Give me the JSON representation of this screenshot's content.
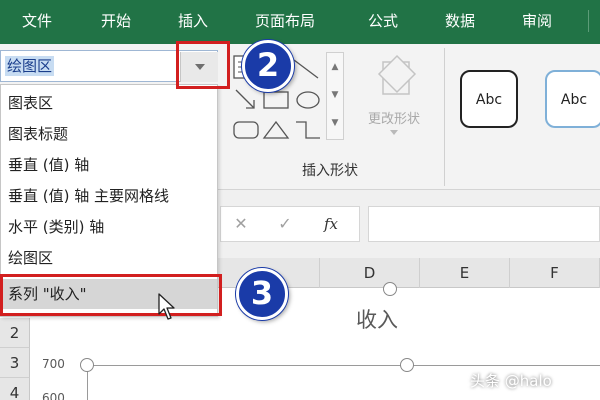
{
  "ribbon_tabs": [
    "文件",
    "开始",
    "插入",
    "页面布局",
    "公式",
    "数据",
    "审阅"
  ],
  "chart_element_selector": {
    "value": "绘图区",
    "options": [
      "图表区",
      "图表标题",
      "垂直 (值) 轴",
      "垂直 (值) 轴 主要网格线",
      "水平 (类别) 轴",
      "绘图区",
      "系列 \"收入\""
    ],
    "highlighted_option": "系列 \"收入\""
  },
  "insert_shapes": {
    "group_label": "插入形状",
    "change_shape_label": "更改形状"
  },
  "shape_styles": [
    "Abc",
    "Abc"
  ],
  "formula_bar": {
    "cancel_icon": "✕",
    "enter_icon": "✓",
    "fx_label": "fx"
  },
  "column_headers": [
    "D",
    "E",
    "F"
  ],
  "row_headers": [
    "2",
    "3",
    "4"
  ],
  "chart": {
    "title": "收入",
    "y_tick_labels": [
      "700",
      "600"
    ]
  },
  "callouts": [
    "2",
    "3"
  ],
  "watermark": "头条 @halo",
  "colors": {
    "ribbon_green": "#217346",
    "callout_blue": "#1a3ba8",
    "highlight_red": "#d21f1f",
    "selection_blue": "#c7dcf2"
  }
}
